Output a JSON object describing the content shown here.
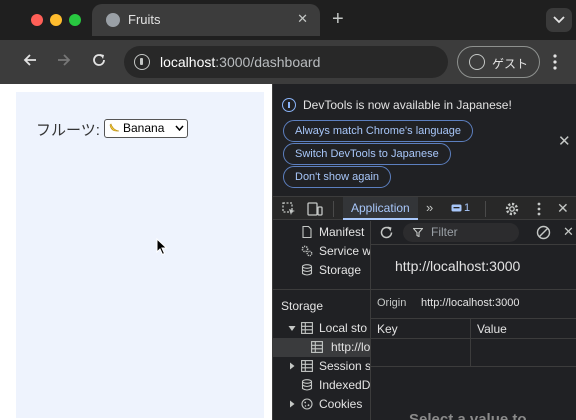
{
  "browser": {
    "tab": {
      "title": "Fruits"
    },
    "address": {
      "host": "localhost",
      "path": ":3000/dashboard"
    },
    "profile_label": "ゲスト"
  },
  "page": {
    "fruit_label": "フルーツ:",
    "fruit_select": {
      "value": "Banana",
      "emoji": "banana-emoji"
    }
  },
  "devtools": {
    "infobar": {
      "message": "DevTools is now available in Japanese!",
      "buttons": [
        "Always match Chrome's language",
        "Switch DevTools to Japanese",
        "Don't show again"
      ]
    },
    "tabs": {
      "active": "Application",
      "more": "»",
      "issues_count": "1"
    },
    "sidebar": {
      "items": [
        {
          "label": "Manifest",
          "icon": "document-icon"
        },
        {
          "label": "Service w",
          "icon": "gears-icon"
        },
        {
          "label": "Storage",
          "icon": "database-icon"
        }
      ],
      "storage_section": "Storage",
      "storage_items": [
        {
          "label": "Local sto",
          "icon": "table-icon",
          "expanded": true
        },
        {
          "label": "http://lo",
          "icon": "table-icon",
          "selected": true
        },
        {
          "label": "Session s",
          "icon": "table-icon",
          "expanded": false
        },
        {
          "label": "IndexedD",
          "icon": "database-icon"
        },
        {
          "label": "Cookies",
          "icon": "cookie-icon",
          "expanded": false
        }
      ]
    },
    "panel": {
      "filter_placeholder": "Filter",
      "origin_heading": "http://localhost:3000",
      "origin_label": "Origin",
      "origin_value": "http://localhost:3000",
      "columns": [
        "Key",
        "Value"
      ],
      "empty_message": "Select a value to"
    }
  },
  "colors": {
    "accent": "#a8c7fa",
    "page_background": "#eef3fd",
    "traffic_close": "#ff5f57",
    "traffic_minimize": "#febc2e",
    "traffic_maximize": "#28c840"
  }
}
